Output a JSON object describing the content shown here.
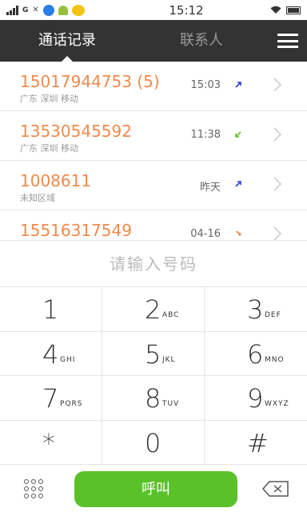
{
  "statusbar": {
    "time": "15:12",
    "network": "G"
  },
  "tabs": {
    "call_log": "通话记录",
    "contacts": "联系人"
  },
  "calls": [
    {
      "number": "15017944753 (5)",
      "location": "广东 深圳  移动",
      "time": "15:03",
      "type": "outgoing"
    },
    {
      "number": "13530545592",
      "location": "广东 深圳  移动",
      "time": "11:38",
      "type": "incoming"
    },
    {
      "number": "1008611",
      "location": "未知区域",
      "time": "昨天",
      "type": "outgoing"
    },
    {
      "number": "15516317549",
      "location": "",
      "time": "04-16",
      "type": "missed"
    }
  ],
  "input": {
    "placeholder": "请输入号码"
  },
  "keys": [
    {
      "digit": "1",
      "letters": ""
    },
    {
      "digit": "2",
      "letters": "ABC"
    },
    {
      "digit": "3",
      "letters": "DEF"
    },
    {
      "digit": "4",
      "letters": "GHI"
    },
    {
      "digit": "5",
      "letters": "JKL"
    },
    {
      "digit": "6",
      "letters": "MNO"
    },
    {
      "digit": "7",
      "letters": "PQRS"
    },
    {
      "digit": "8",
      "letters": "TUV"
    },
    {
      "digit": "9",
      "letters": "WXYZ"
    },
    {
      "digit": "*",
      "letters": ""
    },
    {
      "digit": "0",
      "letters": ""
    },
    {
      "digit": "#",
      "letters": ""
    }
  ],
  "call_button": {
    "label": "呼叫"
  },
  "colors": {
    "accent": "#f08a4b",
    "call_green": "#5bc12a",
    "topbar": "#333333"
  }
}
